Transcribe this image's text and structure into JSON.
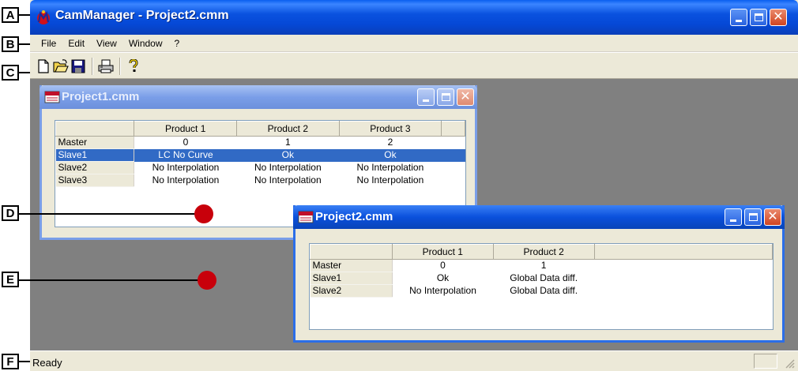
{
  "callouts": [
    {
      "letter": "A"
    },
    {
      "letter": "B"
    },
    {
      "letter": "C"
    },
    {
      "letter": "D"
    },
    {
      "letter": "E"
    },
    {
      "letter": "F"
    }
  ],
  "app": {
    "title": "CamManager - Project2.cmm",
    "icon": "cammanager-logo-icon"
  },
  "menu": [
    "File",
    "Edit",
    "View",
    "Window",
    "?"
  ],
  "toolbar": {
    "buttons": [
      "new-document-icon",
      "open-folder-icon",
      "save-disk-icon",
      "print-icon",
      "help-question-icon"
    ]
  },
  "status": {
    "text": "Ready"
  },
  "child_windows": [
    {
      "title": "Project1.cmm",
      "icon": "cmm-document-icon",
      "active": false,
      "columns": [
        "Product 1",
        "Product 2",
        "Product 3"
      ],
      "rows": [
        {
          "label": "Master",
          "cells": [
            "0",
            "1",
            "2"
          ]
        },
        {
          "label": "Slave1",
          "cells": [
            "LC No Curve",
            "Ok",
            "Ok"
          ],
          "selected": true
        },
        {
          "label": "Slave2",
          "cells": [
            "No Interpolation",
            "No Interpolation",
            "No Interpolation"
          ]
        },
        {
          "label": "Slave3",
          "cells": [
            "No Interpolation",
            "No Interpolation",
            "No Interpolation"
          ]
        }
      ]
    },
    {
      "title": "Project2.cmm",
      "icon": "cmm-document-icon",
      "active": true,
      "columns": [
        "Product 1",
        "Product 2"
      ],
      "rows": [
        {
          "label": "Master",
          "cells": [
            "0",
            "1"
          ]
        },
        {
          "label": "Slave1",
          "cells": [
            "Ok",
            "Global Data diff."
          ]
        },
        {
          "label": "Slave2",
          "cells": [
            "No Interpolation",
            "Global Data diff."
          ]
        }
      ]
    }
  ],
  "colors": {
    "titlebar": "#0a52df",
    "selection": "#316ac5",
    "workspace": "#808080",
    "callout_dot": "#c8000b"
  }
}
